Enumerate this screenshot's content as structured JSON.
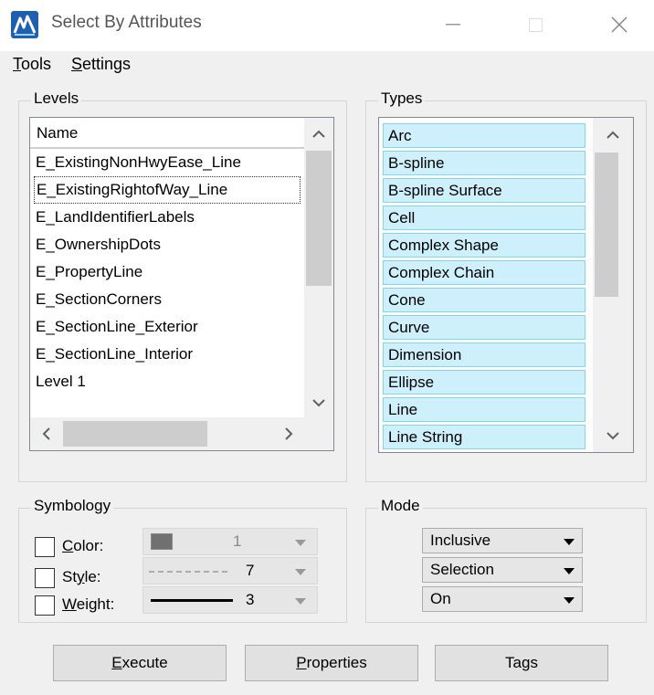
{
  "window": {
    "title": "Select By Attributes",
    "controls": [
      "minimize",
      "maximize",
      "close"
    ]
  },
  "menu": [
    {
      "label": "Tools",
      "mnemonic": "T"
    },
    {
      "label": "Settings",
      "mnemonic": "S"
    }
  ],
  "levels": {
    "group_label": "Levels",
    "column_header": "Name",
    "items": [
      "E_ExistingNonHwyEase_Line",
      "E_ExistingRightofWay_Line",
      "E_LandIdentifierLabels",
      "E_OwnershipDots",
      "E_PropertyLine",
      "E_SectionCorners",
      "E_SectionLine_Exterior",
      "E_SectionLine_Interior",
      "Level 1"
    ],
    "focused_index": 1
  },
  "types": {
    "group_label": "Types",
    "items": [
      "Arc",
      "B-spline",
      "B-spline Surface",
      "Cell",
      "Complex Shape",
      "Complex Chain",
      "Cone",
      "Curve",
      "Dimension",
      "Ellipse",
      "Line",
      "Line String"
    ]
  },
  "symbology": {
    "group_label": "Symbology",
    "color": {
      "label": "Color:",
      "mnemonic": "C",
      "value": "1",
      "checked": false
    },
    "style": {
      "label": "Style:",
      "mnemonic": "y",
      "value": "7",
      "checked": false
    },
    "weight": {
      "label": "Weight:",
      "mnemonic": "W",
      "value": "3",
      "checked": false
    }
  },
  "mode": {
    "group_label": "Mode",
    "selects": [
      "Inclusive",
      "Selection",
      "On"
    ]
  },
  "buttons": {
    "execute": {
      "label": "Execute",
      "mnemonic": "E"
    },
    "properties": {
      "label": "Properties",
      "mnemonic": "P"
    },
    "tags": {
      "label": "Tags",
      "mnemonic": "g"
    }
  },
  "colors": {
    "types_highlight": "#cdf0fc",
    "types_highlight_border": "#7fd6f2",
    "swatch": "#707070"
  }
}
